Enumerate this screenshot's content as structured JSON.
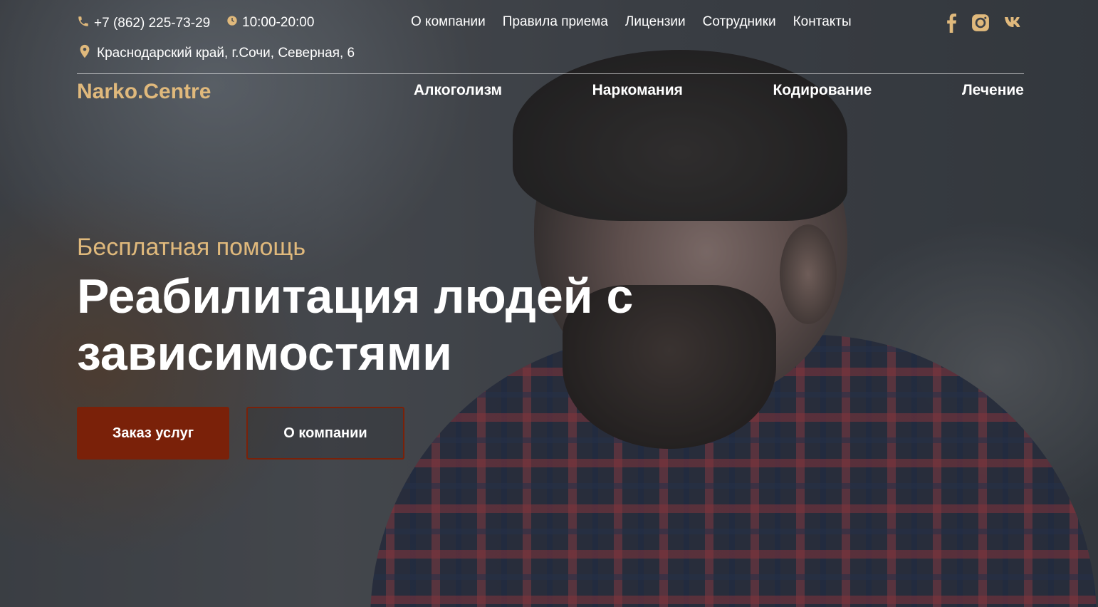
{
  "contacts": {
    "phone": "+7 (862) 225-73-29",
    "hours": "10:00-20:00",
    "address": "Краснодарский край, г.Сочи, Северная, 6"
  },
  "top_nav": [
    "О компании",
    "Правила приема",
    "Лицензии",
    "Сотрудники",
    "Контакты"
  ],
  "socials": [
    "facebook-icon",
    "instagram-icon",
    "vk-icon"
  ],
  "logo": "Narko.Centre",
  "main_nav": [
    "Алкоголизм",
    "Наркомания",
    "Кодирование",
    "Лечение"
  ],
  "hero": {
    "subtitle": "Бесплатная помощь",
    "title": "Реабилитация людей с зависимостями",
    "order_button": "Заказ услуг",
    "about_button": "О компании"
  },
  "colors": {
    "accent_gold": "#e0b97c",
    "button_brown": "#7a2109"
  }
}
